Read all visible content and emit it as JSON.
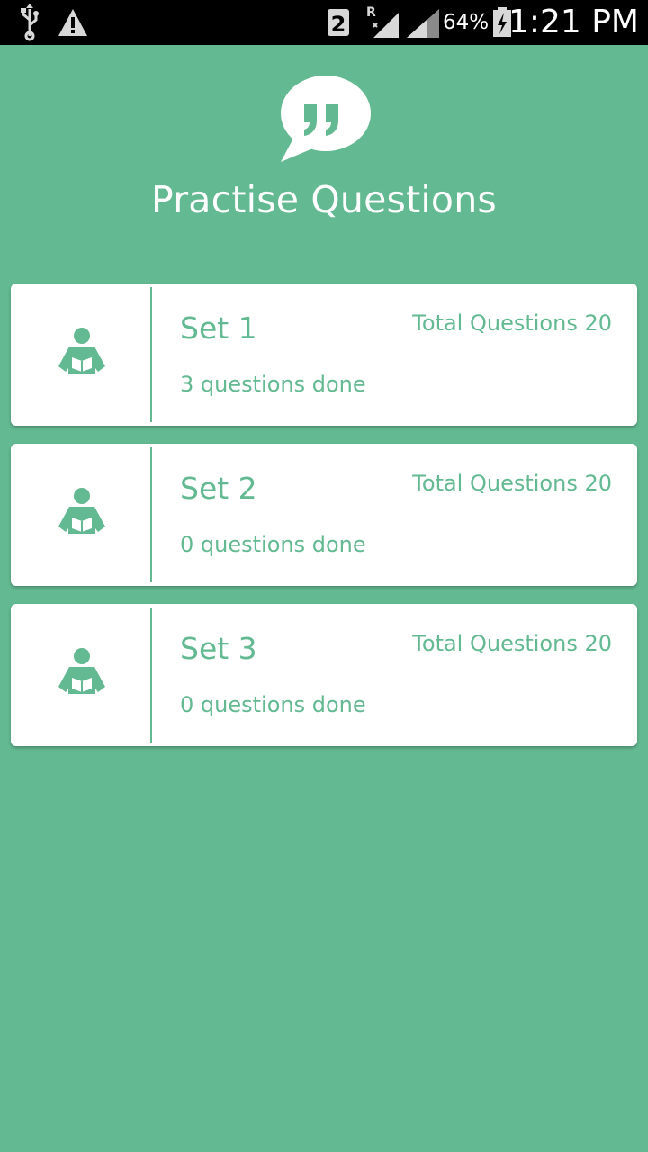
{
  "status_bar": {
    "sim_slot": "2",
    "roaming": "R",
    "battery_percent": "64%",
    "time": "1:21 PM",
    "icons": [
      "usb-icon",
      "warning-icon",
      "sim-icon",
      "signal-icon",
      "signal-icon",
      "battery-charging-icon"
    ]
  },
  "header": {
    "icon": "quote-bubble-icon",
    "title": "Practise Questions"
  },
  "sets": [
    {
      "name": "Set 1",
      "total": "Total Questions 20",
      "done": "3 questions done",
      "icon": "reader-icon"
    },
    {
      "name": "Set 2",
      "total": "Total Questions 20",
      "done": "0 questions done",
      "icon": "reader-icon"
    },
    {
      "name": "Set 3",
      "total": "Total Questions 20",
      "done": "0 questions done",
      "icon": "reader-icon"
    }
  ],
  "colors": {
    "background": "#63b991",
    "accent": "#63b991",
    "card": "#ffffff",
    "status_bar": "#000000"
  }
}
